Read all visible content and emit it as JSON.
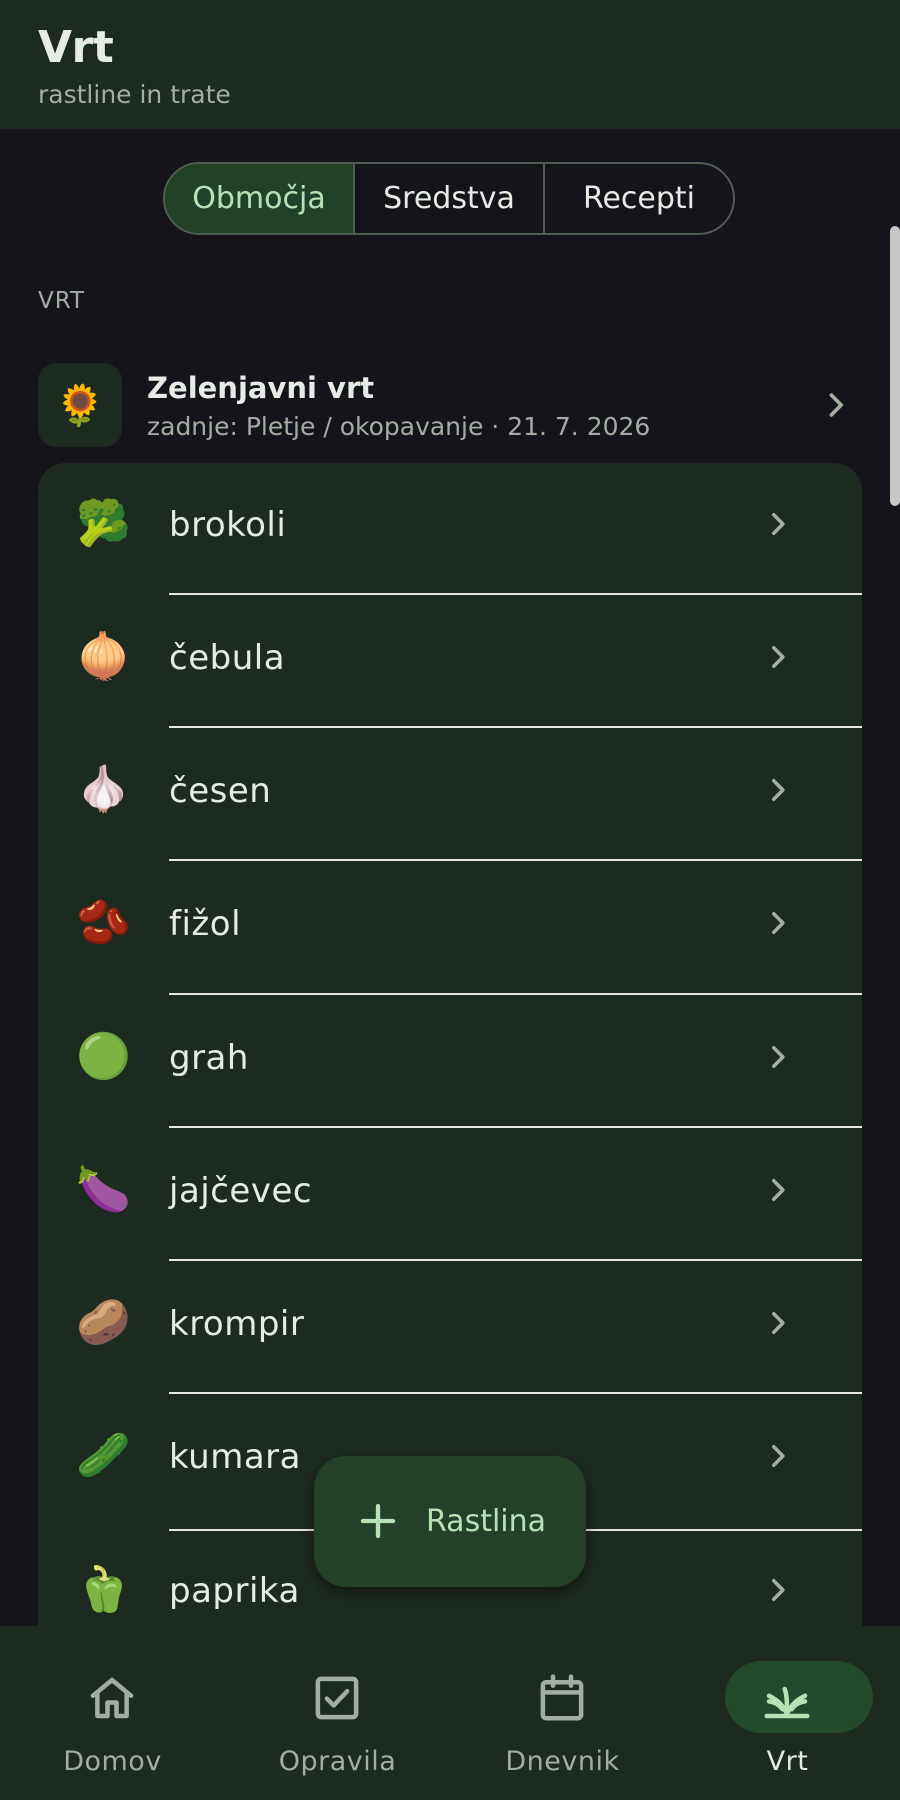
{
  "header": {
    "title": "Vrt",
    "subtitle": "rastline in trate"
  },
  "tabs": [
    {
      "label": "Območja",
      "active": true
    },
    {
      "label": "Sredstva",
      "active": false
    },
    {
      "label": "Recepti",
      "active": false
    }
  ],
  "section": {
    "label": "VRT"
  },
  "area": {
    "icon": "🌻",
    "name": "Zelenjavni vrt",
    "last": "zadnje: Pletje / okopavanje · 21. 7. 2026"
  },
  "plants": [
    {
      "emoji": "🥦",
      "name": "brokoli"
    },
    {
      "emoji": "🧅",
      "name": "čebula"
    },
    {
      "emoji": "🧄",
      "name": "česen"
    },
    {
      "emoji": "🫘",
      "name": "fižol"
    },
    {
      "emoji": "🟢",
      "name": "grah"
    },
    {
      "emoji": "🍆",
      "name": "jajčevec"
    },
    {
      "emoji": "🥔",
      "name": "krompir"
    },
    {
      "emoji": "🥒",
      "name": "kumara"
    },
    {
      "emoji": "🫑",
      "name": "paprika"
    }
  ],
  "fab": {
    "label": "Rastlina",
    "icon": "plus-icon"
  },
  "nav": [
    {
      "label": "Domov",
      "icon": "home-icon",
      "active": false
    },
    {
      "label": "Opravila",
      "icon": "checkbox-icon",
      "active": false
    },
    {
      "label": "Dnevnik",
      "icon": "calendar-icon",
      "active": false
    },
    {
      "label": "Vrt",
      "icon": "sprout-icon",
      "active": true
    }
  ],
  "colors": {
    "background": "#15141b",
    "surface": "#1d2a20",
    "accent": "#224129",
    "accent_text": "#b6e3b5"
  }
}
